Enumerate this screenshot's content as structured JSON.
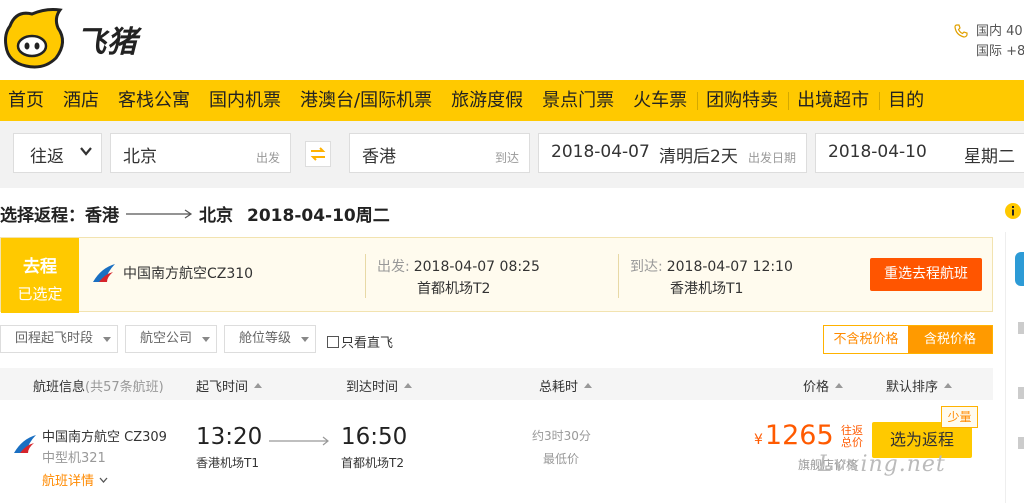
{
  "header": {
    "logo_text": "飞猪",
    "hotline_domestic": "国内 40",
    "hotline_intl": "国际 +8"
  },
  "nav": {
    "items": [
      {
        "label": "首页"
      },
      {
        "label": "酒店"
      },
      {
        "label": "客栈公寓"
      },
      {
        "label": "国内机票"
      },
      {
        "label": "港澳台/国际机票"
      },
      {
        "label": "旅游度假"
      },
      {
        "label": "景点门票"
      },
      {
        "label": "火车票"
      },
      {
        "label": "团购特卖"
      },
      {
        "label": "出境超市"
      },
      {
        "label": "目的"
      }
    ]
  },
  "search": {
    "trip_type": "往返",
    "from_city": "北京",
    "from_label": "出发",
    "to_city": "香港",
    "to_label": "到达",
    "depart_date": "2018-04-07",
    "depart_note": "清明后2天",
    "depart_label": "出发日期",
    "return_date": "2018-04-10",
    "return_weekday": "星期二"
  },
  "selection_title": {
    "prefix": "选择返程：",
    "from": "香港",
    "to": "北京",
    "date": "2018-04-10周二"
  },
  "outbound": {
    "tag_line1": "去程",
    "tag_line2": "已选定",
    "airline": "中国南方航空CZ310",
    "dep_label": "出发:",
    "dep_time": "2018-04-07 08:25",
    "dep_airport": "首都机场T2",
    "arr_label": "到达:",
    "arr_time": "2018-04-07 12:10",
    "arr_airport": "香港机场T1",
    "reselect_label": "重选去程航班"
  },
  "filters": {
    "dep_time": "回程起飞时段",
    "airline": "航空公司",
    "cabin": "舱位等级",
    "direct_only": "只看直飞",
    "price_excl_tax": "不含税价格",
    "price_incl_tax": "含税价格"
  },
  "columns": {
    "flight_info": "航班信息",
    "flight_count": "(共57条航班)",
    "dep_time": "起飞时间",
    "arr_time": "到达时间",
    "duration": "总耗时",
    "price": "价格",
    "default_sort": "默认排序"
  },
  "flights": [
    {
      "airline": "中国南方航空 CZ309",
      "aircraft": "中型机321",
      "detail_label": "航班详情",
      "dep_time": "13:20",
      "dep_airport": "香港机场T1",
      "arr_time": "16:50",
      "arr_airport": "首都机场T2",
      "duration": "约3时30分",
      "low_price_note": "最低价",
      "currency": "¥",
      "price": "1265",
      "price_note": "往返总价",
      "shop_note": "旗舰店价格",
      "select_label": "选为返程",
      "badge": "少量"
    }
  ],
  "watermark": "Lvxing.net",
  "colors": {
    "brand_yellow": "#ffc900",
    "accent_orange": "#ff5500",
    "price_red": "#ff5a00"
  }
}
